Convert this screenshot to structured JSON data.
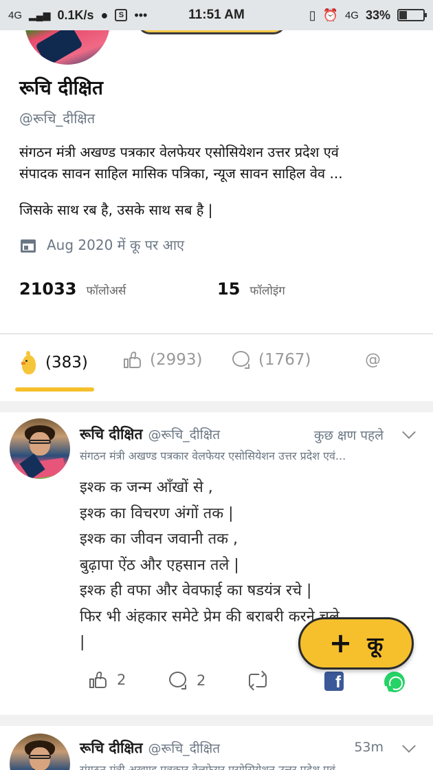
{
  "status_bar": {
    "network": "4G",
    "speed": "0.1K/s",
    "time": "11:51 AM",
    "network_right": "4G",
    "battery": "33%",
    "battery_level": 0.33
  },
  "profile": {
    "name": "रूचि दीक्षित",
    "handle": "@रूचि_दीक्षित",
    "bio_line1": "संगठन मंत्री अखण्ड पत्रकार वेलफेयर एसोसियेशन उत्तर प्रदेश एवं",
    "bio_line2": "संपादक सावन साहिल मासिक पत्रिका, न्यूज सावन साहिल वेव ...",
    "motto": "जिसके साथ रब है, उसके साथ सब है |",
    "joined": "Aug 2020 में कू पर आए",
    "followers_count": "21033",
    "followers_label": "फॉलोअर्स",
    "following_count": "15",
    "following_label": "फॉलोइंग"
  },
  "tabs": [
    {
      "label": "(383)",
      "icon": "koo-chick-icon",
      "active": true
    },
    {
      "label": "(2993)",
      "icon": "thumbs-up-icon",
      "active": false
    },
    {
      "label": "(1767)",
      "icon": "comment-icon",
      "active": false
    },
    {
      "label": "@",
      "icon": "mention-icon",
      "active": false
    }
  ],
  "posts": [
    {
      "author": "रूचि दीक्षित",
      "handle": "@रूचि_दीक्षित",
      "time": "कुछ क्षण पहले",
      "subtitle": "संगठन मंत्री अखण्ड पत्रकार वेलफेयर एसोसियेशन उत्तर प्रदेश एवं...",
      "lines": [
        "इश्क क जन्म आँखों से ,",
        "इश्क का विचरण अंगों तक |",
        "इश्क का जीवन जवानी तक ,",
        "बुढ़ापा ऐंठ और एहसान तले |",
        "इश्क ही वफा और वेवफाई का षडयंत्र रचे |",
        "फिर भी अंहकार समेटे  प्रेम की बराबरी करने चले",
        "|"
      ],
      "likes": "2",
      "comments": "2"
    },
    {
      "author": "रूचि दीक्षित",
      "handle": "@रूचि_दीक्षित",
      "time": "53m",
      "subtitle": "संगठन मंत्री अखण्ड पत्रकार वेलफेयर एसोसियेशन उत्तर प्रदेश एवं..."
    }
  ],
  "fab": {
    "label": "कू",
    "icon": "plus-icon"
  },
  "colors": {
    "accent": "#f5c02c",
    "facebook": "#3b5998",
    "whatsapp": "#25d366",
    "muted": "#6b7784"
  }
}
